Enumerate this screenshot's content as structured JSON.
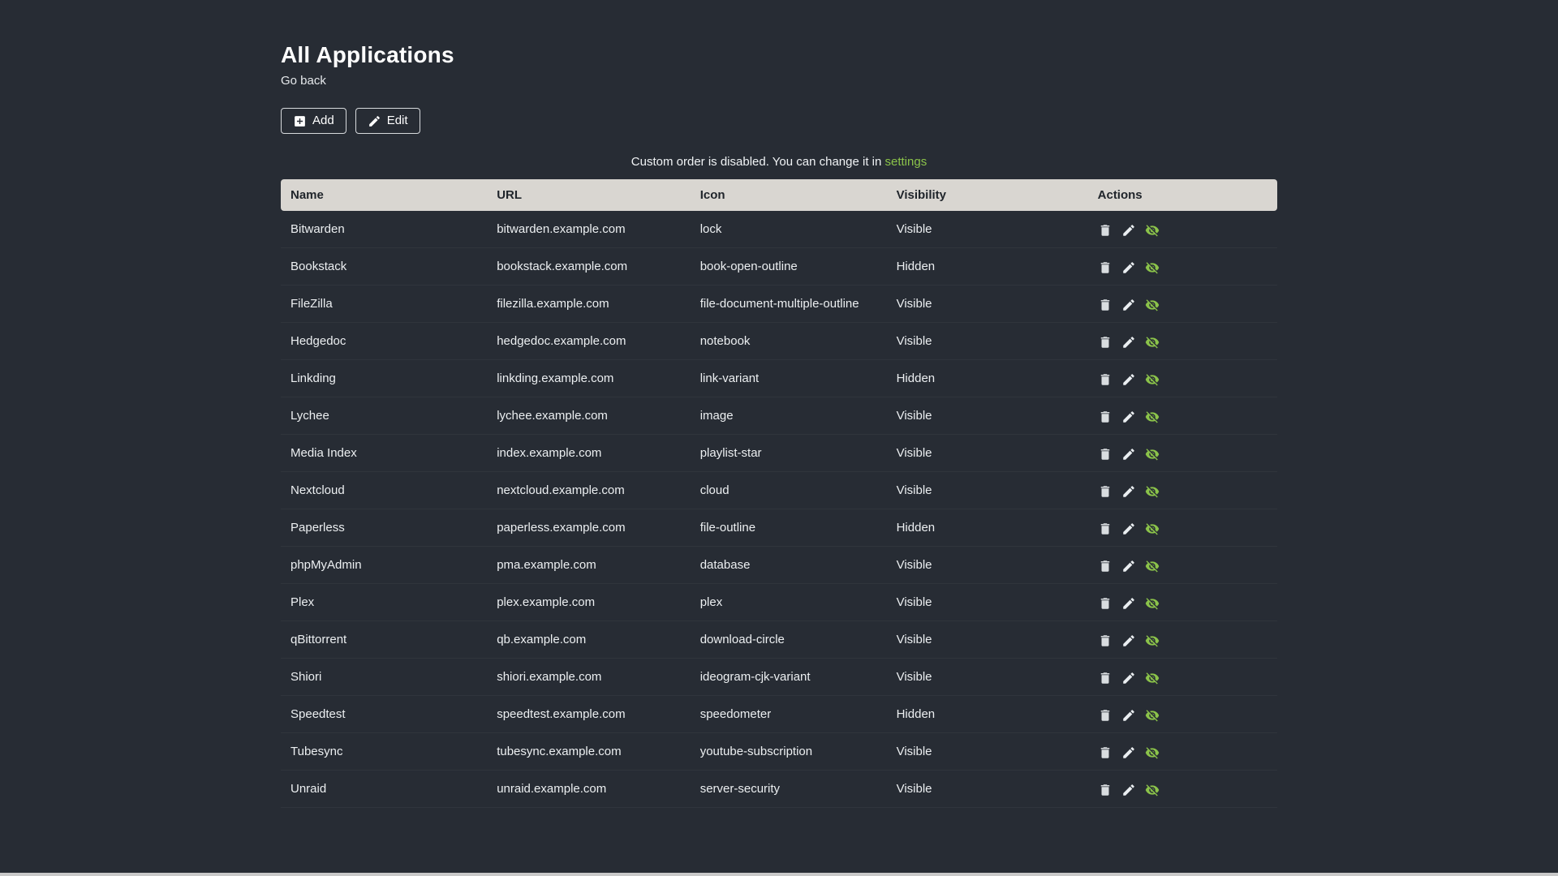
{
  "colors": {
    "background": "#272c34",
    "accent": "#8bc34a",
    "text": "#eceff1",
    "table_header_bg": "#d9d6d1",
    "table_header_text": "#20252b"
  },
  "page": {
    "title": "All Applications",
    "go_back_label": "Go back"
  },
  "toolbar": {
    "add_label": "Add",
    "edit_label": "Edit",
    "add_icon": "plus-box-icon",
    "edit_icon": "pencil-icon"
  },
  "notice": {
    "text": "Custom order is disabled. You can change it in ",
    "link_label": "settings"
  },
  "table": {
    "headers": [
      "Name",
      "URL",
      "Icon",
      "Visibility",
      "Actions"
    ],
    "row_action_icons": [
      "trash-icon",
      "pencil-icon",
      "eye-off-icon"
    ],
    "rows": [
      {
        "name": "Bitwarden",
        "url": "bitwarden.example.com",
        "icon": "lock",
        "visibility": "Visible"
      },
      {
        "name": "Bookstack",
        "url": "bookstack.example.com",
        "icon": "book-open-outline",
        "visibility": "Hidden"
      },
      {
        "name": "FileZilla",
        "url": "filezilla.example.com",
        "icon": "file-document-multiple-outline",
        "visibility": "Visible"
      },
      {
        "name": "Hedgedoc",
        "url": "hedgedoc.example.com",
        "icon": "notebook",
        "visibility": "Visible"
      },
      {
        "name": "Linkding",
        "url": "linkding.example.com",
        "icon": "link-variant",
        "visibility": "Hidden"
      },
      {
        "name": "Lychee",
        "url": "lychee.example.com",
        "icon": "image",
        "visibility": "Visible"
      },
      {
        "name": "Media Index",
        "url": "index.example.com",
        "icon": "playlist-star",
        "visibility": "Visible"
      },
      {
        "name": "Nextcloud",
        "url": "nextcloud.example.com",
        "icon": "cloud",
        "visibility": "Visible"
      },
      {
        "name": "Paperless",
        "url": "paperless.example.com",
        "icon": "file-outline",
        "visibility": "Hidden"
      },
      {
        "name": "phpMyAdmin",
        "url": "pma.example.com",
        "icon": "database",
        "visibility": "Visible"
      },
      {
        "name": "Plex",
        "url": "plex.example.com",
        "icon": "plex",
        "visibility": "Visible"
      },
      {
        "name": "qBittorrent",
        "url": "qb.example.com",
        "icon": "download-circle",
        "visibility": "Visible"
      },
      {
        "name": "Shiori",
        "url": "shiori.example.com",
        "icon": "ideogram-cjk-variant",
        "visibility": "Visible"
      },
      {
        "name": "Speedtest",
        "url": "speedtest.example.com",
        "icon": "speedometer",
        "visibility": "Hidden"
      },
      {
        "name": "Tubesync",
        "url": "tubesync.example.com",
        "icon": "youtube-subscription",
        "visibility": "Visible"
      },
      {
        "name": "Unraid",
        "url": "unraid.example.com",
        "icon": "server-security",
        "visibility": "Visible"
      }
    ]
  }
}
